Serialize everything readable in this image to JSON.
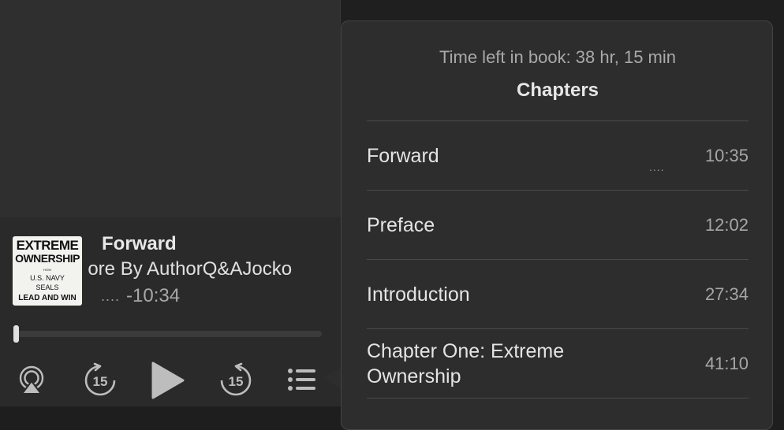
{
  "now_playing": {
    "cover": {
      "line1": "EXTREME",
      "line2": "OWNERSHIP",
      "line3": "HOW",
      "line4": "U.S. NAVY",
      "line5": "SEALS",
      "line6": "LEAD AND WIN"
    },
    "title": "Forward",
    "author": "lore By AuthorQ&AJocko",
    "status_dots": "....",
    "remaining": "-10:34",
    "progress_fraction": 0.0
  },
  "controls": {
    "airplay_icon": "airplay-icon",
    "skip_back_label": "15",
    "play_icon": "play-icon",
    "skip_forward_label": "15",
    "chapters_icon": "list-icon"
  },
  "chapters_popover": {
    "time_left": "Time left in book: 38 hr, 15 min",
    "heading": "Chapters",
    "items": [
      {
        "name": "Forward",
        "duration": "10:35",
        "playing_indicator": "...."
      },
      {
        "name": "Preface",
        "duration": "12:02"
      },
      {
        "name": "Introduction",
        "duration": "27:34"
      },
      {
        "name": "Chapter One: Extreme Ownership",
        "duration": "41:10"
      }
    ]
  },
  "colors": {
    "background": "#1e1e1e",
    "panel": "#2d2d2d",
    "text_primary": "#e6e6e6",
    "text_secondary": "#a6a6a6"
  }
}
